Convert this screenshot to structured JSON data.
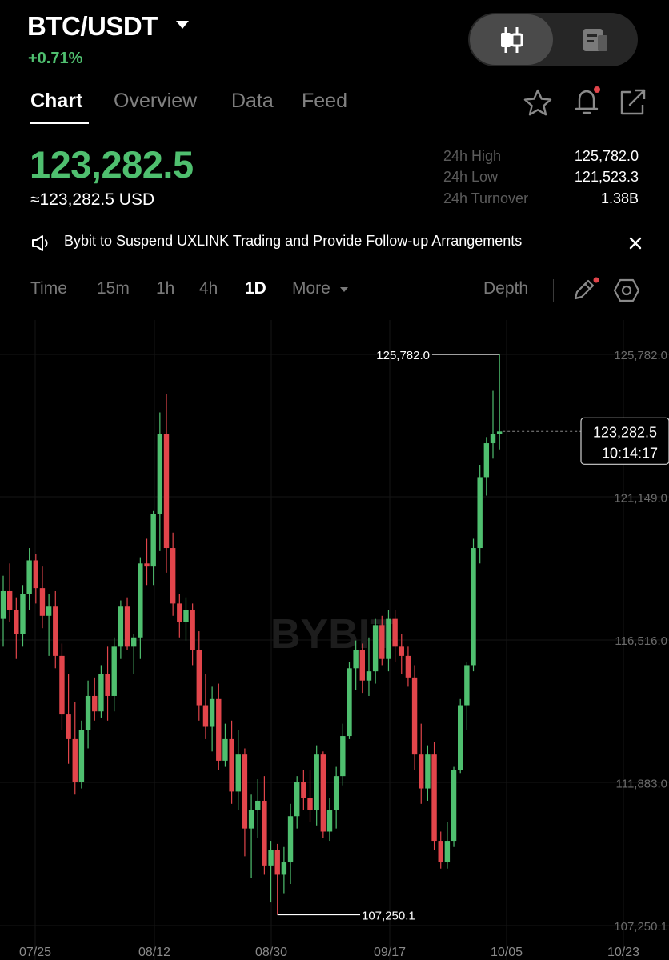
{
  "header": {
    "pair": "BTC/USDT",
    "change_pct": "+0.71%",
    "colors": {
      "up": "#4fbf6f",
      "down": "#e2454b",
      "background": "#000000"
    }
  },
  "tabs": [
    {
      "label": "Chart",
      "active": true
    },
    {
      "label": "Overview",
      "active": false
    },
    {
      "label": "Data",
      "active": false
    },
    {
      "label": "Feed",
      "active": false
    }
  ],
  "price": {
    "last": "123,282.5",
    "usd": "≈123,282.5 USD"
  },
  "stats": [
    {
      "label": "24h High",
      "value": "125,782.0"
    },
    {
      "label": "24h Low",
      "value": "121,523.3"
    },
    {
      "label": "24h Turnover",
      "value": "1.38B"
    }
  ],
  "notice": {
    "text": "Bybit to Suspend UXLINK Trading and Provide Follow-up Arrangements"
  },
  "timeframes": [
    {
      "label": "Time",
      "active": false
    },
    {
      "label": "15m",
      "active": false
    },
    {
      "label": "1h",
      "active": false
    },
    {
      "label": "4h",
      "active": false
    },
    {
      "label": "1D",
      "active": true
    },
    {
      "label": "More",
      "active": false
    }
  ],
  "depth_label": "Depth",
  "chart_data": {
    "type": "candlestick",
    "watermark": "BYBIT",
    "y_ticks": [
      "125,782.0",
      "121,149.0",
      "116,516.0",
      "111,883.0",
      "107,250.1"
    ],
    "x_ticks": [
      "07/25",
      "08/12",
      "08/30",
      "09/17",
      "10/05",
      "10/23"
    ],
    "ylim": [
      107250.1,
      125782.0
    ],
    "max_label": "125,782.0",
    "min_label": "107,250.1",
    "last_price": "123,282.5",
    "countdown": "10:14:17",
    "ohlc": [
      [
        117200,
        118600,
        116300,
        118100
      ],
      [
        118100,
        119000,
        117100,
        117500
      ],
      [
        117500,
        117900,
        115900,
        116700
      ],
      [
        116700,
        118300,
        116300,
        118000
      ],
      [
        118000,
        119500,
        117500,
        119100
      ],
      [
        119100,
        119300,
        117700,
        118200
      ],
      [
        118200,
        118900,
        116900,
        117300
      ],
      [
        117300,
        118000,
        116000,
        117600
      ],
      [
        117600,
        118100,
        115600,
        116000
      ],
      [
        116000,
        116400,
        113600,
        114100
      ],
      [
        114100,
        115400,
        112500,
        113300
      ],
      [
        113300,
        114500,
        111500,
        111900
      ],
      [
        111900,
        113900,
        111700,
        113600
      ],
      [
        113600,
        115200,
        113000,
        114700
      ],
      [
        114700,
        115300,
        113900,
        114200
      ],
      [
        114200,
        115700,
        114000,
        115400
      ],
      [
        115400,
        116300,
        113900,
        114700
      ],
      [
        114700,
        116600,
        114200,
        116300
      ],
      [
        116300,
        117800,
        115900,
        117600
      ],
      [
        117600,
        117900,
        116200,
        116300
      ],
      [
        116300,
        116700,
        115400,
        116600
      ],
      [
        116600,
        119200,
        115900,
        119000
      ],
      [
        119000,
        119800,
        118300,
        118900
      ],
      [
        118900,
        120700,
        118300,
        120600
      ],
      [
        120600,
        123900,
        119400,
        123200
      ],
      [
        123200,
        124500,
        118700,
        119500
      ],
      [
        119500,
        120000,
        117300,
        117700
      ],
      [
        117700,
        118000,
        116600,
        117100
      ],
      [
        117100,
        117900,
        116500,
        117500
      ],
      [
        117500,
        117700,
        115700,
        116200
      ],
      [
        116200,
        116800,
        113900,
        114400
      ],
      [
        114400,
        115400,
        113300,
        113700
      ],
      [
        113700,
        115000,
        112900,
        114600
      ],
      [
        114600,
        115100,
        112300,
        112600
      ],
      [
        112600,
        113800,
        112400,
        113300
      ],
      [
        113300,
        113900,
        111200,
        111600
      ],
      [
        111600,
        113600,
        111000,
        112800
      ],
      [
        112800,
        113000,
        109500,
        110400
      ],
      [
        110400,
        111500,
        108800,
        111000
      ],
      [
        111000,
        112000,
        110100,
        111300
      ],
      [
        111300,
        112100,
        108900,
        109200
      ],
      [
        109200,
        110000,
        108000,
        109700
      ],
      [
        109700,
        109900,
        107600,
        108900
      ],
      [
        108900,
        109800,
        108300,
        109300
      ],
      [
        109300,
        111200,
        108600,
        110800
      ],
      [
        110800,
        112100,
        110400,
        111900
      ],
      [
        111900,
        112300,
        111000,
        111400
      ],
      [
        111400,
        112300,
        110600,
        111000
      ],
      [
        111000,
        113100,
        110500,
        112800
      ],
      [
        112800,
        112900,
        110100,
        110300
      ],
      [
        110300,
        111400,
        110000,
        111000
      ],
      [
        111000,
        112400,
        110400,
        112100
      ],
      [
        112100,
        113800,
        111800,
        113400
      ],
      [
        113400,
        115800,
        113300,
        115600
      ],
      [
        115600,
        116500,
        114900,
        116200
      ],
      [
        116200,
        116400,
        114800,
        115200
      ],
      [
        115200,
        116600,
        114700,
        115500
      ],
      [
        115500,
        117200,
        115100,
        117000
      ],
      [
        117000,
        117300,
        115700,
        115900
      ],
      [
        115900,
        117500,
        115500,
        117200
      ],
      [
        117200,
        117500,
        115800,
        116300
      ],
      [
        116300,
        116700,
        115400,
        116000
      ],
      [
        116000,
        116300,
        115000,
        115300
      ],
      [
        115300,
        115700,
        112300,
        112800
      ],
      [
        112800,
        113800,
        111200,
        111700
      ],
      [
        111700,
        113100,
        111300,
        112800
      ],
      [
        112800,
        113200,
        109700,
        110000
      ],
      [
        110000,
        110300,
        109100,
        109300
      ],
      [
        109300,
        110600,
        109100,
        110000
      ],
      [
        110000,
        112400,
        109800,
        112300
      ],
      [
        112300,
        114600,
        112200,
        114400
      ],
      [
        114400,
        115800,
        113600,
        115700
      ],
      [
        115700,
        119800,
        115500,
        119500
      ],
      [
        119500,
        122200,
        119000,
        121800
      ],
      [
        121800,
        123100,
        121200,
        122900
      ],
      [
        122900,
        124600,
        122400,
        123200
      ],
      [
        123200,
        125782,
        122700,
        123282.5
      ]
    ]
  }
}
